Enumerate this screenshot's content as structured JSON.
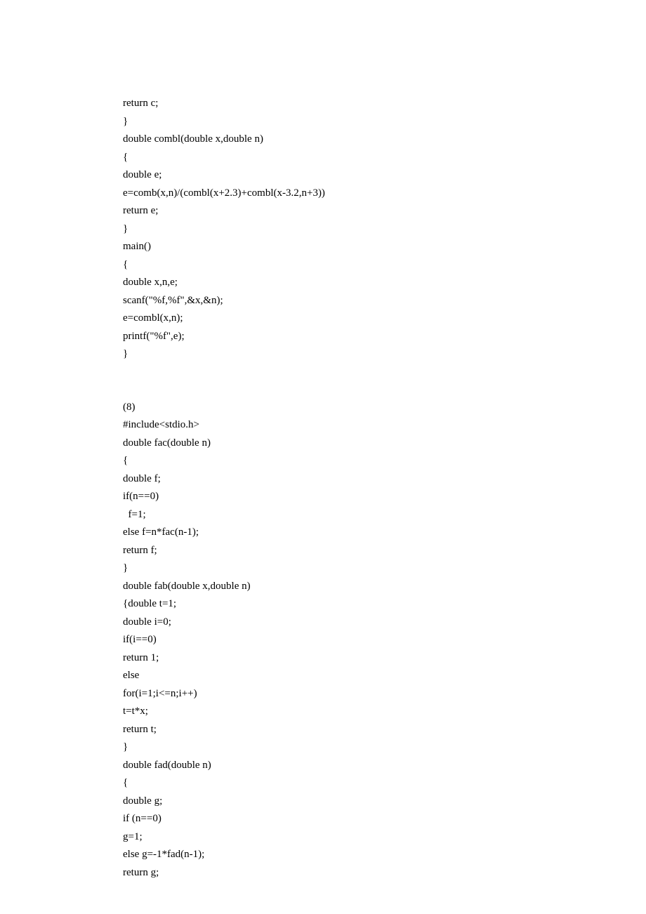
{
  "code": {
    "block1": "return c;\n}\ndouble combl(double x,double n)\n{\ndouble e;\ne=comb(x,n)/(combl(x+2.3)+combl(x-3.2,n+3))\nreturn e;\n}\nmain()\n{\ndouble x,n,e;\nscanf(\"%f,%f\",&x,&n);\ne=combl(x,n);\nprintf(\"%f\",e);\n}",
    "block2": "(8)\n#include<stdio.h>\ndouble fac(double n)\n{\ndouble f;\nif(n==0)\n  f=1;\nelse f=n*fac(n-1);\nreturn f;\n}\ndouble fab(double x,double n)\n{double t=1;\ndouble i=0;\nif(i==0)\nreturn 1;\nelse\nfor(i=1;i<=n;i++)\nt=t*x;\nreturn t;\n}\ndouble fad(double n)\n{\ndouble g;\nif (n==0)\ng=1;\nelse g=-1*fad(n-1);\nreturn g;"
  }
}
